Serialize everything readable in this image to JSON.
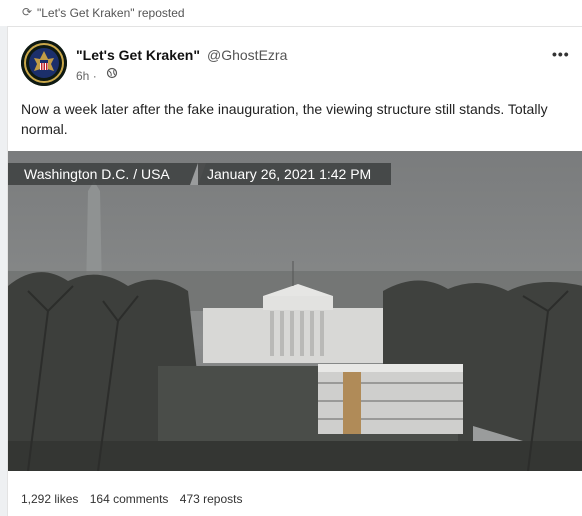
{
  "repost": {
    "icon": "repost-icon",
    "text": "\"Let's Get Kraken\" reposted"
  },
  "post": {
    "author_name": "\"Let's Get Kraken\"",
    "author_handle": "@GhostEzra",
    "time": "6h",
    "separator": "·",
    "visibility_icon": "globe-icon",
    "more_icon": "more-icon",
    "more_label": "•••",
    "text": "Now a week later after the fake inauguration, the viewing structure still stands. Totally normal."
  },
  "image": {
    "location_label": "Washington D.C. / USA",
    "date_label": "January 26, 2021 1:42 PM"
  },
  "stats": {
    "likes": "1,292 likes",
    "comments": "164 comments",
    "reposts": "473 reposts"
  }
}
